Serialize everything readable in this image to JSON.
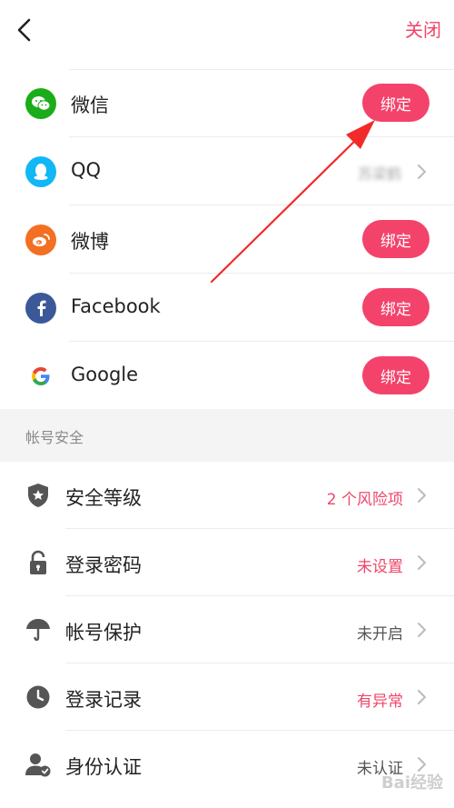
{
  "header": {
    "close_label": "关闭"
  },
  "social": {
    "wechat": {
      "label": "微信",
      "button": "绑定"
    },
    "qq": {
      "label": "QQ",
      "value": "苏梁鹤"
    },
    "weibo": {
      "label": "微博",
      "button": "绑定"
    },
    "facebook": {
      "label": "Facebook",
      "button": "绑定"
    },
    "google": {
      "label": "Google",
      "button": "绑定"
    }
  },
  "section": {
    "title": "帐号安全"
  },
  "security": {
    "level": {
      "label": "安全等级",
      "value": "2 个风险项"
    },
    "password": {
      "label": "登录密码",
      "value": "未设置"
    },
    "protection": {
      "label": "帐号保护",
      "value": "未开启"
    },
    "records": {
      "label": "登录记录",
      "value": "有异常"
    },
    "identity": {
      "label": "身份认证",
      "value": "未认证"
    }
  },
  "watermark": "Bai经验",
  "colors": {
    "accent": "#f3436b",
    "wechat": "#1aad19",
    "qq": "#12b7f5",
    "weibo": "#f36f21",
    "facebook": "#3b5998"
  }
}
